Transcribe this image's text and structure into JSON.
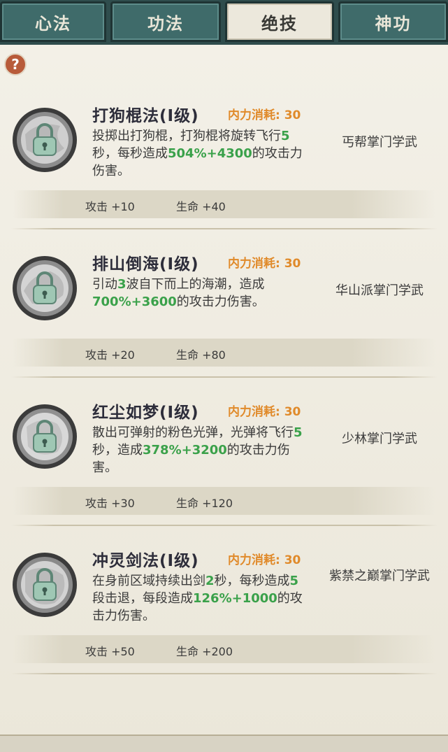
{
  "tabs": [
    {
      "label": "心法",
      "active": false
    },
    {
      "label": "功法",
      "active": false
    },
    {
      "label": "绝技",
      "active": true
    },
    {
      "label": "神功",
      "active": false
    }
  ],
  "help_icon": "question-mark",
  "skills": [
    {
      "name": "打狗棍法(Ⅰ级)",
      "cost": "内力消耗: 30",
      "desc_parts": [
        {
          "t": "投掷出打狗棍，打狗棍将旋转飞行"
        },
        {
          "t": "5",
          "g": true
        },
        {
          "t": "秒，每秒造成"
        },
        {
          "t": "504%+4300",
          "g": true
        },
        {
          "t": "的攻击力伤害。"
        }
      ],
      "source": "丐帮掌门学武",
      "stat_attack": "攻击 +10",
      "stat_life": "生命 +40"
    },
    {
      "name": "排山倒海(Ⅰ级)",
      "cost": "内力消耗: 30",
      "desc_parts": [
        {
          "t": "引动"
        },
        {
          "t": "3",
          "g": true
        },
        {
          "t": "波自下而上的海潮，造成"
        },
        {
          "t": "700%+3600",
          "g": true
        },
        {
          "t": "的攻击力伤害。"
        }
      ],
      "source": "华山派掌门学武",
      "stat_attack": "攻击 +20",
      "stat_life": "生命 +80"
    },
    {
      "name": "红尘如梦(Ⅰ级)",
      "cost": "内力消耗: 30",
      "desc_parts": [
        {
          "t": "散出可弹射的粉色光弹，光弹将飞行"
        },
        {
          "t": "5",
          "g": true
        },
        {
          "t": "秒，造成"
        },
        {
          "t": "378%+3200",
          "g": true
        },
        {
          "t": "的攻击力伤害。"
        }
      ],
      "source": "少林掌门学武",
      "stat_attack": "攻击 +30",
      "stat_life": "生命 +120"
    },
    {
      "name": "冲灵剑法(Ⅰ级)",
      "cost": "内力消耗: 30",
      "desc_parts": [
        {
          "t": "在身前区域持续出剑"
        },
        {
          "t": "2",
          "g": true
        },
        {
          "t": "秒，每秒造成"
        },
        {
          "t": "5",
          "g": true
        },
        {
          "t": "段击退，每段造成"
        },
        {
          "t": "126%+1000",
          "g": true
        },
        {
          "t": "的攻击力伤害。"
        }
      ],
      "source": "紫禁之巅掌门学武",
      "stat_attack": "攻击 +50",
      "stat_life": "生命 +200"
    }
  ]
}
